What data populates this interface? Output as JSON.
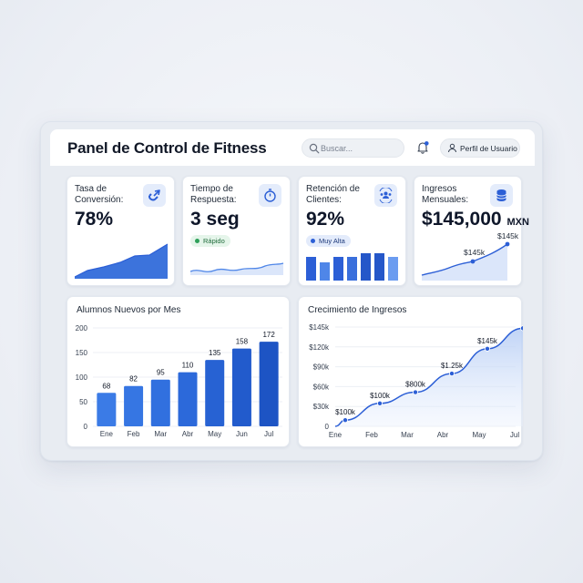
{
  "header": {
    "title": "Panel de Control de Fitness",
    "search_placeholder": "Buscar...",
    "profile_label": "Perfil de Usuario"
  },
  "kpis": [
    {
      "label": "Tasa de Conversión:",
      "value": "78%",
      "icon": "magnet-icon"
    },
    {
      "label": "Tiempo de Respuesta:",
      "value": "3 seg",
      "badge": "Rápido",
      "icon": "stopwatch-icon"
    },
    {
      "label": "Retención de Clientes:",
      "value": "92%",
      "badge": "Muy Alta",
      "icon": "users-cycle-icon"
    },
    {
      "label": "Ingresos Mensuales:",
      "value": "$145,000",
      "unit": "MXN",
      "icon": "coins-icon",
      "mini_labels": [
        "$145k",
        "$145k"
      ]
    }
  ],
  "colors": {
    "accent": "#2c5fd6",
    "accent_light": "#4f86e8",
    "success": "#2fa05a"
  },
  "chart_data": [
    {
      "type": "bar",
      "title": "Alumnos Nuevos por Mes",
      "categories": [
        "Ene",
        "Feb",
        "Mar",
        "Abr",
        "May",
        "Jun",
        "Jul"
      ],
      "values": [
        68,
        82,
        95,
        110,
        135,
        158,
        172
      ],
      "yticks": [
        "0",
        "50",
        "100",
        "150",
        "200"
      ],
      "ylim": [
        0,
        200
      ],
      "grid": true
    },
    {
      "type": "line",
      "title": "Crecimiento de Ingresos",
      "x": [
        "Ene",
        "Feb",
        "Mar",
        "Abr",
        "May",
        "Jul"
      ],
      "values": [
        10,
        37,
        55,
        85,
        125,
        158
      ],
      "yticks": [
        "0",
        "$30k",
        "$60k",
        "$90k",
        "$120k",
        "$145k"
      ],
      "point_labels": [
        "$100k",
        "$100k",
        "$800k",
        "$1.25k",
        "$145k"
      ],
      "ylim": [
        0,
        160
      ],
      "grid": true
    }
  ]
}
